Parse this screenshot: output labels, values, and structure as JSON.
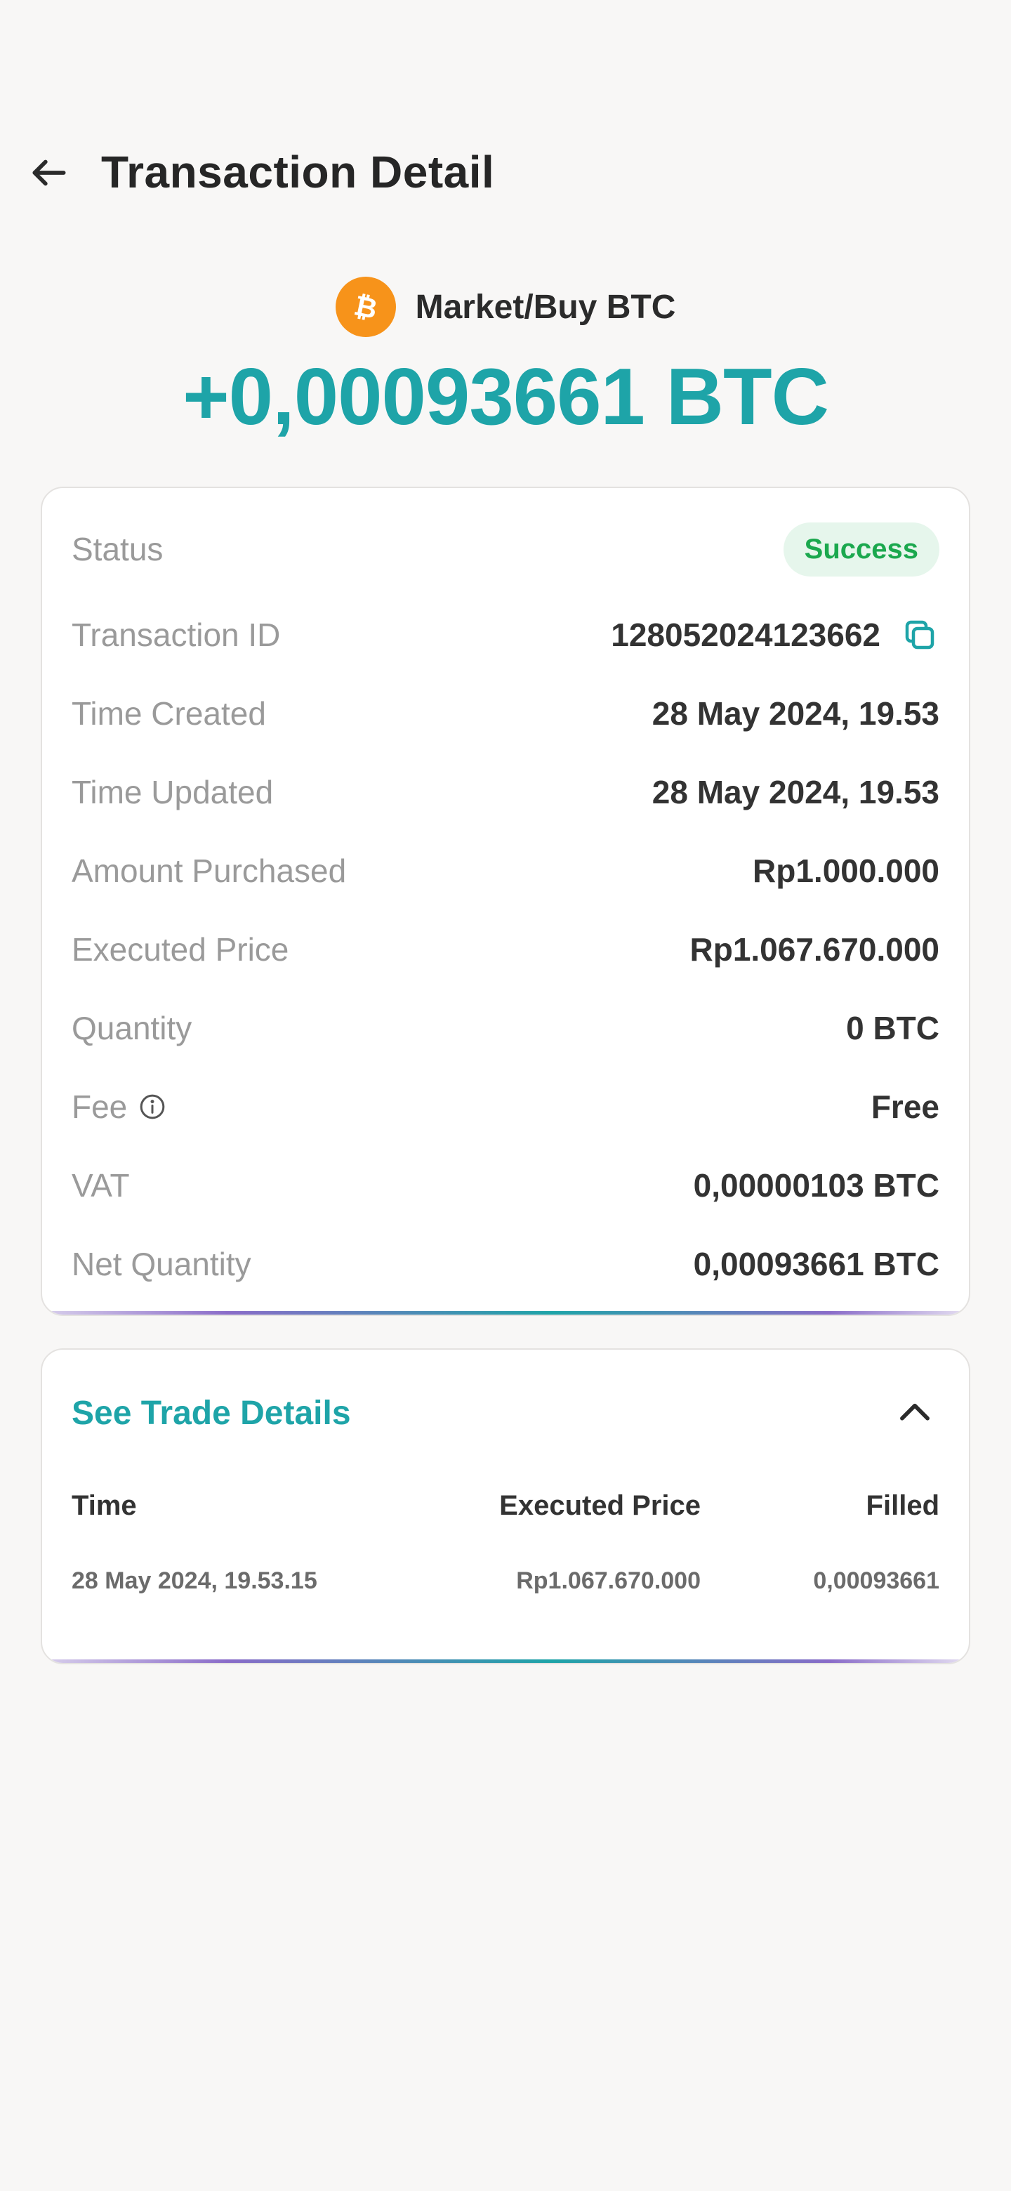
{
  "header": {
    "title": "Transaction Detail"
  },
  "hero": {
    "coin_icon": "bitcoin-icon",
    "coin_color": "#f7931a",
    "order_type": "Market/Buy BTC",
    "amount": "+0,00093661 BTC",
    "amount_color": "#1ea4a8"
  },
  "details": {
    "status_label": "Status",
    "status_value": "Success",
    "transaction_id_label": "Transaction ID",
    "transaction_id_value": "128052024123662",
    "time_created_label": "Time Created",
    "time_created_value": "28 May 2024, 19.53",
    "time_updated_label": "Time Updated",
    "time_updated_value": "28 May 2024, 19.53",
    "amount_purchased_label": "Amount Purchased",
    "amount_purchased_value": "Rp1.000.000",
    "executed_price_label": "Executed Price",
    "executed_price_value": "Rp1.067.670.000",
    "quantity_label": "Quantity",
    "quantity_value": "0 BTC",
    "fee_label": "Fee",
    "fee_value": "Free",
    "vat_label": "VAT",
    "vat_value": "0,00000103 BTC",
    "net_quantity_label": "Net Quantity",
    "net_quantity_value": "0,00093661 BTC"
  },
  "trade": {
    "title": "See Trade Details",
    "columns": [
      "Time",
      "Executed Price",
      "Filled"
    ],
    "rows": [
      [
        "28 May 2024, 19.53.15",
        "Rp1.067.670.000",
        "0,00093661"
      ]
    ]
  },
  "colors": {
    "accent": "#1ea4a8",
    "success": "#1ba84e",
    "success_bg": "#e6f6ec",
    "background": "#f8f7f6"
  }
}
